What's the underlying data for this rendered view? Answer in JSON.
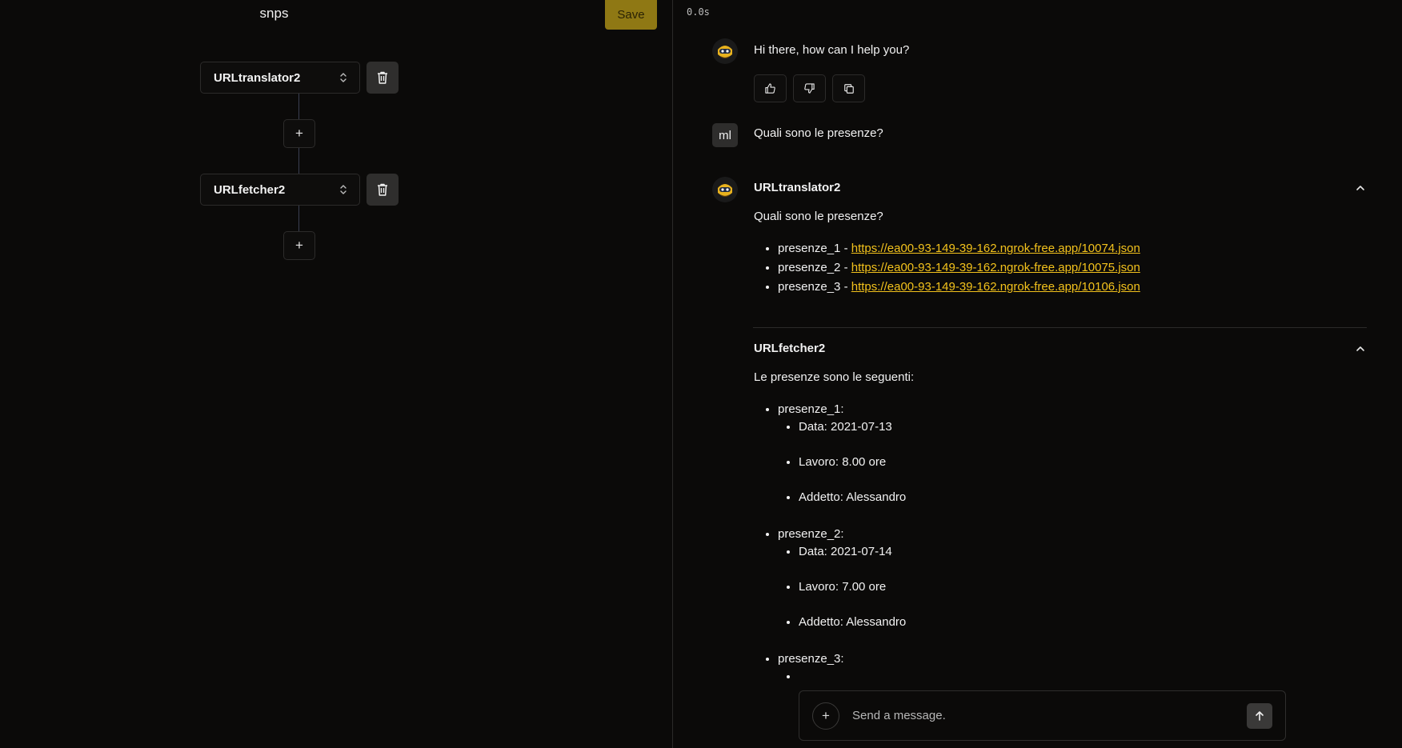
{
  "builder": {
    "title": "snps",
    "save_label": "Save",
    "steps": [
      {
        "label": "URLtranslator2"
      },
      {
        "label": "URLfetcher2"
      }
    ],
    "add_symbol": "+"
  },
  "chat": {
    "timer": "0.0s",
    "greeting": "Hi there, how can I help you?",
    "user_initials": "ml",
    "user_message": "Quali sono le presenze?",
    "agents": [
      {
        "name": "URLtranslator2",
        "intro": "Quali sono le presenze?",
        "items": [
          {
            "key": "presenze_1",
            "sep": " - ",
            "url": "https://ea00-93-149-39-162.ngrok-free.app/10074.json"
          },
          {
            "key": "presenze_2",
            "sep": " - ",
            "url": "https://ea00-93-149-39-162.ngrok-free.app/10075.json"
          },
          {
            "key": "presenze_3",
            "sep": " - ",
            "url": "https://ea00-93-149-39-162.ngrok-free.app/10106.json"
          }
        ]
      },
      {
        "name": "URLfetcher2",
        "intro": "Le presenze sono le seguenti:",
        "groups": [
          {
            "title": "presenze_1:",
            "fields": [
              "Data: 2021-07-13",
              "Lavoro: 8.00 ore",
              "Addetto: Alessandro"
            ]
          },
          {
            "title": "presenze_2:",
            "fields": [
              "Data: 2021-07-14",
              "Lavoro: 7.00 ore",
              "Addetto: Alessandro"
            ]
          },
          {
            "title": "presenze_3:"
          }
        ]
      }
    ],
    "composer": {
      "placeholder": "Send a message.",
      "add_symbol": "+"
    }
  },
  "colors": {
    "background": "#0b0a09",
    "save_button": "#8f7814",
    "link": "#f3c21c",
    "trash_button": "#2f2e2d"
  },
  "icons": [
    "chevron-up-down-icon",
    "trash-icon",
    "plus-icon",
    "thumbs-up-icon",
    "thumbs-down-icon",
    "copy-icon",
    "chevron-up-icon",
    "arrow-up-icon",
    "bot-avatar-icon"
  ]
}
